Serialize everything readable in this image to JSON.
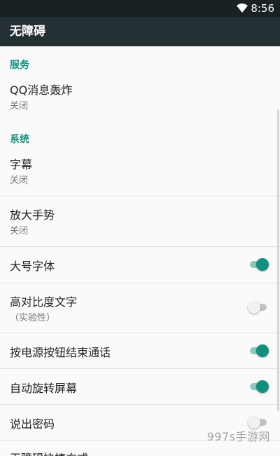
{
  "status_bar": {
    "time": "8:56",
    "wifi_icon": "wifi-icon"
  },
  "app_bar": {
    "title": "无障碍"
  },
  "sections": {
    "services": {
      "header": "服务",
      "items": [
        {
          "title": "QQ消息轰炸",
          "subtitle": "关闭"
        }
      ]
    },
    "system": {
      "header": "系统",
      "items": [
        {
          "title": "字幕",
          "subtitle": "关闭"
        },
        {
          "title": "放大手势",
          "subtitle": "关闭"
        },
        {
          "title": "大号字体",
          "toggle": true
        },
        {
          "title": "高对比度文字",
          "subtitle": "（实验性）",
          "toggle": false
        },
        {
          "title": "按电源按钮结束通话",
          "toggle": true
        },
        {
          "title": "自动旋转屏幕",
          "toggle": true
        },
        {
          "title": "说出密码",
          "toggle": false
        },
        {
          "title": "无障碍快捷方式"
        }
      ]
    }
  },
  "watermark": "997s手游网",
  "colors": {
    "accent": "#11907e",
    "app_bar": "#243034",
    "status_bar": "#1a2124"
  }
}
